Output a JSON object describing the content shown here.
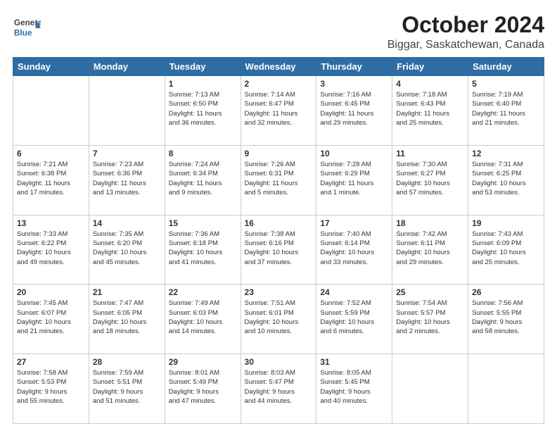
{
  "header": {
    "logo_general": "General",
    "logo_blue": "Blue",
    "title": "October 2024",
    "subtitle": "Biggar, Saskatchewan, Canada"
  },
  "weekdays": [
    "Sunday",
    "Monday",
    "Tuesday",
    "Wednesday",
    "Thursday",
    "Friday",
    "Saturday"
  ],
  "weeks": [
    [
      {
        "day": "",
        "info": ""
      },
      {
        "day": "",
        "info": ""
      },
      {
        "day": "1",
        "info": "Sunrise: 7:13 AM\nSunset: 6:50 PM\nDaylight: 11 hours\nand 36 minutes."
      },
      {
        "day": "2",
        "info": "Sunrise: 7:14 AM\nSunset: 6:47 PM\nDaylight: 11 hours\nand 32 minutes."
      },
      {
        "day": "3",
        "info": "Sunrise: 7:16 AM\nSunset: 6:45 PM\nDaylight: 11 hours\nand 29 minutes."
      },
      {
        "day": "4",
        "info": "Sunrise: 7:18 AM\nSunset: 6:43 PM\nDaylight: 11 hours\nand 25 minutes."
      },
      {
        "day": "5",
        "info": "Sunrise: 7:19 AM\nSunset: 6:40 PM\nDaylight: 11 hours\nand 21 minutes."
      }
    ],
    [
      {
        "day": "6",
        "info": "Sunrise: 7:21 AM\nSunset: 6:38 PM\nDaylight: 11 hours\nand 17 minutes."
      },
      {
        "day": "7",
        "info": "Sunrise: 7:23 AM\nSunset: 6:36 PM\nDaylight: 11 hours\nand 13 minutes."
      },
      {
        "day": "8",
        "info": "Sunrise: 7:24 AM\nSunset: 6:34 PM\nDaylight: 11 hours\nand 9 minutes."
      },
      {
        "day": "9",
        "info": "Sunrise: 7:26 AM\nSunset: 6:31 PM\nDaylight: 11 hours\nand 5 minutes."
      },
      {
        "day": "10",
        "info": "Sunrise: 7:28 AM\nSunset: 6:29 PM\nDaylight: 11 hours\nand 1 minute."
      },
      {
        "day": "11",
        "info": "Sunrise: 7:30 AM\nSunset: 6:27 PM\nDaylight: 10 hours\nand 57 minutes."
      },
      {
        "day": "12",
        "info": "Sunrise: 7:31 AM\nSunset: 6:25 PM\nDaylight: 10 hours\nand 53 minutes."
      }
    ],
    [
      {
        "day": "13",
        "info": "Sunrise: 7:33 AM\nSunset: 6:22 PM\nDaylight: 10 hours\nand 49 minutes."
      },
      {
        "day": "14",
        "info": "Sunrise: 7:35 AM\nSunset: 6:20 PM\nDaylight: 10 hours\nand 45 minutes."
      },
      {
        "day": "15",
        "info": "Sunrise: 7:36 AM\nSunset: 6:18 PM\nDaylight: 10 hours\nand 41 minutes."
      },
      {
        "day": "16",
        "info": "Sunrise: 7:38 AM\nSunset: 6:16 PM\nDaylight: 10 hours\nand 37 minutes."
      },
      {
        "day": "17",
        "info": "Sunrise: 7:40 AM\nSunset: 6:14 PM\nDaylight: 10 hours\nand 33 minutes."
      },
      {
        "day": "18",
        "info": "Sunrise: 7:42 AM\nSunset: 6:11 PM\nDaylight: 10 hours\nand 29 minutes."
      },
      {
        "day": "19",
        "info": "Sunrise: 7:43 AM\nSunset: 6:09 PM\nDaylight: 10 hours\nand 25 minutes."
      }
    ],
    [
      {
        "day": "20",
        "info": "Sunrise: 7:45 AM\nSunset: 6:07 PM\nDaylight: 10 hours\nand 21 minutes."
      },
      {
        "day": "21",
        "info": "Sunrise: 7:47 AM\nSunset: 6:05 PM\nDaylight: 10 hours\nand 18 minutes."
      },
      {
        "day": "22",
        "info": "Sunrise: 7:49 AM\nSunset: 6:03 PM\nDaylight: 10 hours\nand 14 minutes."
      },
      {
        "day": "23",
        "info": "Sunrise: 7:51 AM\nSunset: 6:01 PM\nDaylight: 10 hours\nand 10 minutes."
      },
      {
        "day": "24",
        "info": "Sunrise: 7:52 AM\nSunset: 5:59 PM\nDaylight: 10 hours\nand 6 minutes."
      },
      {
        "day": "25",
        "info": "Sunrise: 7:54 AM\nSunset: 5:57 PM\nDaylight: 10 hours\nand 2 minutes."
      },
      {
        "day": "26",
        "info": "Sunrise: 7:56 AM\nSunset: 5:55 PM\nDaylight: 9 hours\nand 58 minutes."
      }
    ],
    [
      {
        "day": "27",
        "info": "Sunrise: 7:58 AM\nSunset: 5:53 PM\nDaylight: 9 hours\nand 55 minutes."
      },
      {
        "day": "28",
        "info": "Sunrise: 7:59 AM\nSunset: 5:51 PM\nDaylight: 9 hours\nand 51 minutes."
      },
      {
        "day": "29",
        "info": "Sunrise: 8:01 AM\nSunset: 5:49 PM\nDaylight: 9 hours\nand 47 minutes."
      },
      {
        "day": "30",
        "info": "Sunrise: 8:03 AM\nSunset: 5:47 PM\nDaylight: 9 hours\nand 44 minutes."
      },
      {
        "day": "31",
        "info": "Sunrise: 8:05 AM\nSunset: 5:45 PM\nDaylight: 9 hours\nand 40 minutes."
      },
      {
        "day": "",
        "info": ""
      },
      {
        "day": "",
        "info": ""
      }
    ]
  ]
}
